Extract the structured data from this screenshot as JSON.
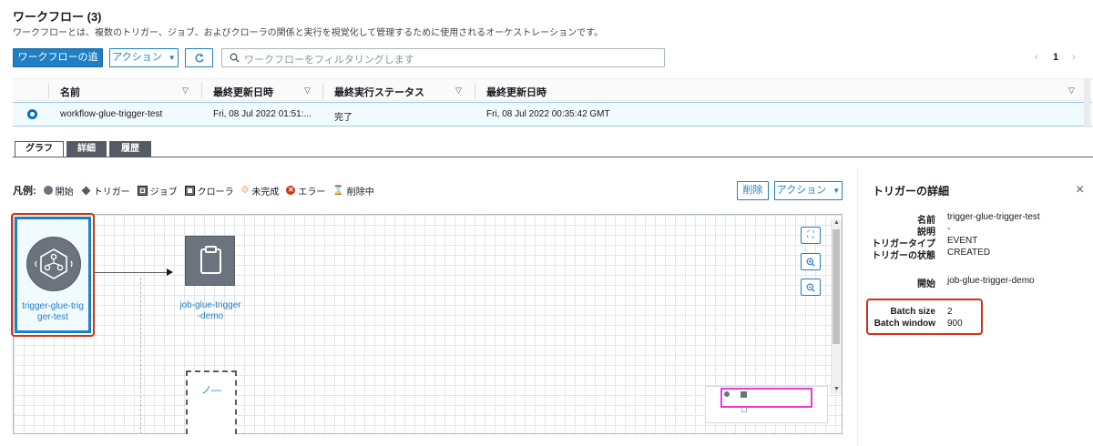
{
  "header": {
    "title": "ワークフロー (3)",
    "description": "ワークフローとは、複数のトリガー、ジョブ、およびクローラの関係と実行を視覚化して管理するために使用されるオーケストレーションです。"
  },
  "toolbar": {
    "add_label": "ワークフローの追加",
    "action_label": "アクション",
    "search_placeholder": "ワークフローをフィルタリングします"
  },
  "pager": {
    "prev": "‹",
    "page": "1",
    "next": "›"
  },
  "table": {
    "columns": [
      "名前",
      "最終更新日時",
      "最終実行ステータス",
      "最終更新日時"
    ],
    "rows": [
      {
        "name": "workflow-glue-trigger-test",
        "modified": "Fri, 08 Jul 2022 01:51:...",
        "status": "完了",
        "updated": "Fri, 08 Jul 2022 00:35:42 GMT"
      }
    ]
  },
  "tabs": [
    "グラフ",
    "詳細",
    "履歴"
  ],
  "legend": {
    "label": "凡例:",
    "items": [
      "開始",
      "トリガー",
      "ジョブ",
      "クローラ",
      "未完成",
      "エラー",
      "削除中"
    ]
  },
  "graph_actions": {
    "delete_label": "削除",
    "action_label": "アクション"
  },
  "graph": {
    "trigger_node": {
      "label_line1": "trigger-glue-trig",
      "label_line2": "ger-test"
    },
    "job_node": {
      "label_line1": "job-glue-trigger",
      "label_line2": "-demo"
    },
    "partial_node": {
      "label": "ノ—"
    }
  },
  "details": {
    "title": "トリガーの詳細",
    "fields": [
      {
        "key": "名前",
        "value": "trigger-glue-trigger-test"
      },
      {
        "key": "説明",
        "value": "-"
      },
      {
        "key": "トリガータイプ",
        "value": "EVENT"
      },
      {
        "key": "トリガーの状態",
        "value": "CREATED"
      },
      {
        "key": "開始",
        "value": "job-glue-trigger-demo"
      },
      {
        "key": "Batch size",
        "value": "2"
      },
      {
        "key": "Batch window",
        "value": "900"
      }
    ]
  },
  "colors": {
    "accent": "#1f7fc4",
    "highlight": "#d13212",
    "minimap_view": "#e838e0"
  }
}
